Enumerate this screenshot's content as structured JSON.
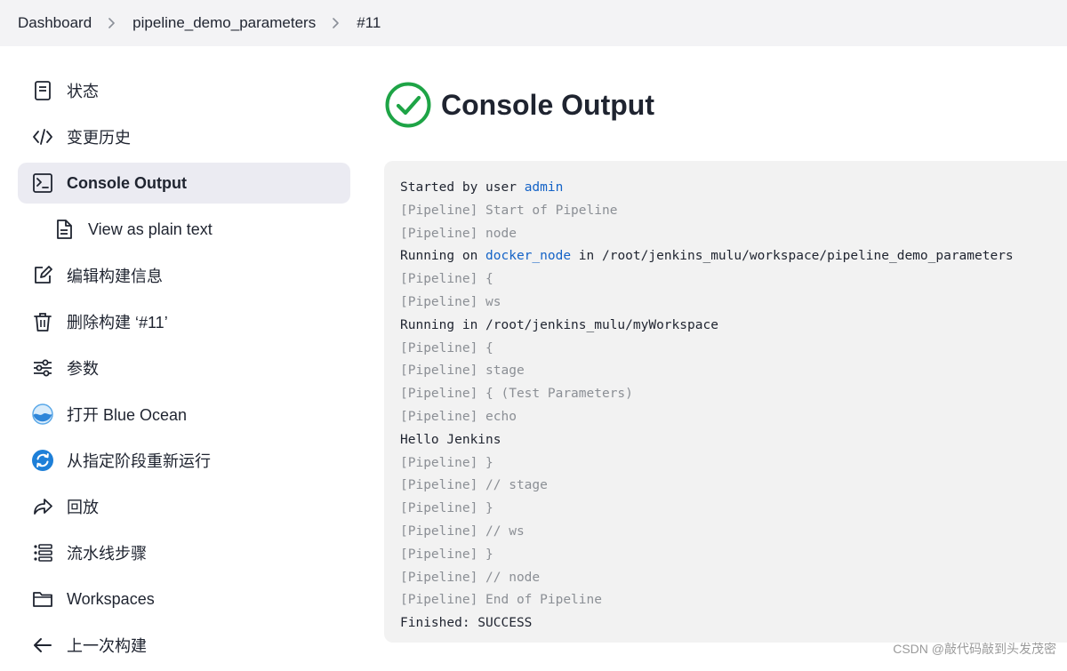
{
  "breadcrumb": {
    "items": [
      "Dashboard",
      "pipeline_demo_parameters",
      "#11"
    ]
  },
  "sidebar": {
    "items": [
      {
        "label": "状态",
        "icon": "document-icon"
      },
      {
        "label": "变更历史",
        "icon": "code-icon"
      },
      {
        "label": "Console Output",
        "icon": "terminal-icon",
        "active": true
      },
      {
        "label": "View as plain text",
        "icon": "file-text-icon",
        "sub": true
      },
      {
        "label": "编辑构建信息",
        "icon": "edit-icon"
      },
      {
        "label": "删除构建 ‘#11’",
        "icon": "trash-icon"
      },
      {
        "label": "参数",
        "icon": "sliders-icon"
      },
      {
        "label": "打开 Blue Ocean",
        "icon": "blue-ocean-icon"
      },
      {
        "label": "从指定阶段重新运行",
        "icon": "restart-stage-icon"
      },
      {
        "label": "回放",
        "icon": "replay-icon"
      },
      {
        "label": "流水线步骤",
        "icon": "list-icon"
      },
      {
        "label": "Workspaces",
        "icon": "folder-icon"
      },
      {
        "label": "上一次构建",
        "icon": "arrow-left-icon"
      }
    ]
  },
  "main": {
    "title": "Console Output",
    "status": "success",
    "status_color": "#1ea446"
  },
  "console": {
    "line1": {
      "prefix": "Started by user ",
      "link": "admin"
    },
    "line2": "[Pipeline] Start of Pipeline",
    "line3": "[Pipeline] node",
    "line4": {
      "prefix": "Running on ",
      "link": "docker_node",
      "suffix": " in /root/jenkins_mulu/workspace/pipeline_demo_parameters"
    },
    "line5": "[Pipeline] {",
    "line6": "[Pipeline] ws",
    "line7": "Running in /root/jenkins_mulu/myWorkspace",
    "line8": "[Pipeline] {",
    "line9": "[Pipeline] stage",
    "line10": "[Pipeline] { (Test Parameters)",
    "line11": "[Pipeline] echo",
    "line12": "Hello Jenkins",
    "line13": "[Pipeline] }",
    "line14": "[Pipeline] // stage",
    "line15": "[Pipeline] }",
    "line16": "[Pipeline] // ws",
    "line17": "[Pipeline] }",
    "line18": "[Pipeline] // node",
    "line19": "[Pipeline] End of Pipeline",
    "line20": "Finished: SUCCESS"
  },
  "watermark": "CSDN @敲代码敲到头发茂密",
  "colors": {
    "link": "#1463c7",
    "breadcrumb_bg": "#f3f3f5",
    "active_bg": "#ebebf2",
    "console_bg": "#f2f2f2"
  }
}
